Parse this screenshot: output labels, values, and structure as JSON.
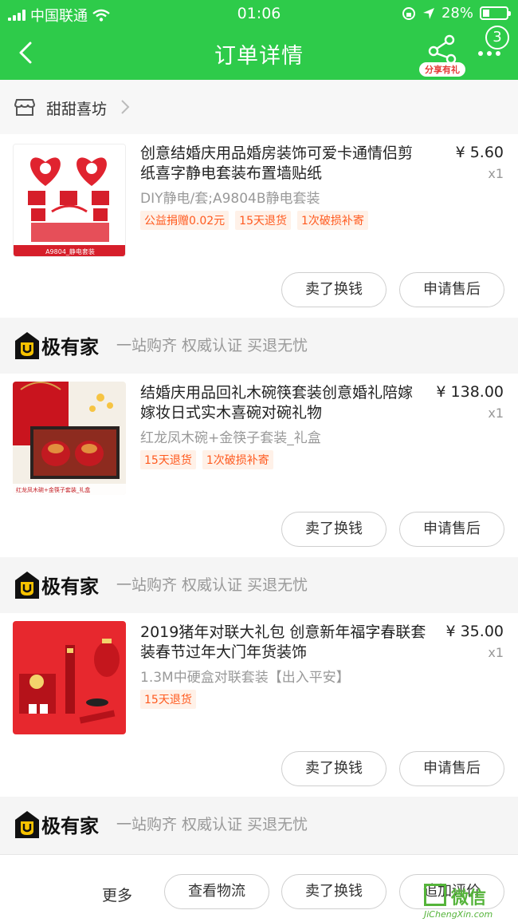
{
  "status": {
    "carrier": "中国联通",
    "time": "01:06",
    "battery": "28%",
    "battery_level": 0.28
  },
  "header": {
    "title": "订单详情",
    "share_label": "分享有礼",
    "badge": "3"
  },
  "shop": {
    "name": "甜甜喜坊"
  },
  "items": [
    {
      "title": "创意结婚庆用品婚房装饰可爱卡通情侣剪纸喜字静电套装布置墙贴纸",
      "price": "¥ 5.60",
      "qty": "x1",
      "spec": "DIY静电/套;A9804B静电套装",
      "tags": [
        "公益捐赠0.02元",
        "15天退货",
        "1次破损补寄"
      ],
      "image_caption": "A9804_静电套装",
      "actions": [
        "卖了换钱",
        "申请售后"
      ]
    },
    {
      "brand": {
        "name": "极有家",
        "slogan": "一站购齐 权威认证 买退无忧"
      },
      "title": "结婚庆用品回礼木碗筷套装创意婚礼陪嫁嫁妆日式实木喜碗对碗礼物",
      "price": "¥ 138.00",
      "qty": "x1",
      "spec": "红龙凤木碗+金筷子套装_礼盒",
      "tags": [
        "15天退货",
        "1次破损补寄"
      ],
      "image_caption": "红龙凤木碗+金筷子套装_礼盒",
      "actions": [
        "卖了换钱",
        "申请售后"
      ]
    },
    {
      "brand": {
        "name": "极有家",
        "slogan": "一站购齐 权威认证 买退无忧"
      },
      "title": "2019猪年对联大礼包 创意新年福字春联套装春节过年大门年货装饰",
      "price": "¥ 35.00",
      "qty": "x1",
      "spec": "1.3M中硬盒对联套装【出入平安】",
      "tags": [
        "15天退货"
      ],
      "actions": [
        "卖了换钱",
        "申请售后"
      ]
    }
  ],
  "last_brand": {
    "name": "极有家",
    "slogan": "一站购齐 权威认证 买退无忧"
  },
  "footer": {
    "more": "更多",
    "actions": [
      "查看物流",
      "卖了换钱",
      "追加评价"
    ]
  },
  "watermark": {
    "text": "微信",
    "sub": "JiChengXin.com"
  }
}
